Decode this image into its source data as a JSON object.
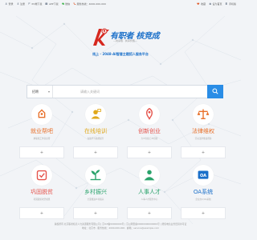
{
  "topbar": {
    "left": [
      {
        "icon": "user-icon",
        "label": "登录"
      },
      {
        "icon": "user-plus-icon",
        "label": "注册"
      },
      {
        "icon": "flag-icon",
        "label": "PC端下载"
      },
      {
        "icon": "app-icon",
        "label": "APP下载"
      },
      {
        "icon": "wechat-icon",
        "label": "微信"
      },
      {
        "icon": "phone-icon",
        "label": "服务热线：4000-000-000"
      }
    ],
    "right": [
      {
        "icon": "heart-icon",
        "label": "收藏"
      },
      {
        "icon": "home-icon",
        "label": "设为首页"
      },
      {
        "icon": "mobile-icon",
        "label": "手机版"
      }
    ]
  },
  "logo": {
    "text": "有职者 核竞成",
    "slogan": "—共享值 · 共享价值—"
  },
  "tagline": "线上 · 2048-AI智慧主题招人服务平台",
  "search": {
    "category": "招聘",
    "placeholder": "请输入关键词"
  },
  "cards": [
    {
      "title": "就业帮吧",
      "desc": "求职找工作就业帮",
      "color": "#e8702a"
    },
    {
      "title": "在线培训",
      "desc": "在线学习技能提升",
      "color": "#e0a81c"
    },
    {
      "title": "创新创业",
      "desc": "大众创业万众创新",
      "color": "#e5534b"
    },
    {
      "title": "法律维权",
      "desc": "劳动法律维权帮助",
      "color": "#e8702a"
    },
    {
      "title": "巩固脱贫",
      "desc": "巩固脱贫攻坚成果",
      "color": "#e5534b"
    },
    {
      "title": "乡村振兴",
      "desc": "全面推进乡村振兴",
      "color": "#2aa36b"
    },
    {
      "title": "人事人才",
      "desc": "人事人才服务中心",
      "color": "#2aa36b"
    },
    {
      "title": "OA系统",
      "desc": "企业办公OA系统",
      "color": "#1a6fc9"
    }
  ],
  "plus_label": "+",
  "footer": [
    "版权所有 北京职者核竞人力资源服务有限公司 | 京ICP备00000000号 | 京公网安备00000000000000号 | 增值电信业务经营许可证",
    "地址：北京市 · 服务热线：4000-000-000 · 邮箱：service@example.com"
  ],
  "colors": {
    "accent": "#2a8de6",
    "brand": "#1a6fc9",
    "logo_red": "#d6281f",
    "background": "#f2f4f7"
  }
}
